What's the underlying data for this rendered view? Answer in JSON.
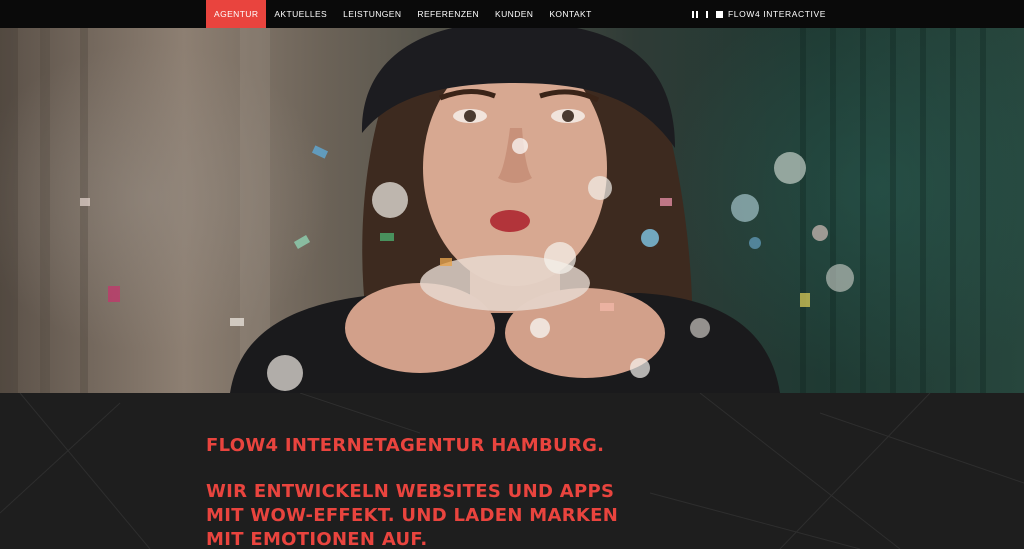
{
  "nav": {
    "items": [
      {
        "label": "AGENTUR",
        "active": true
      },
      {
        "label": "AKTUELLES",
        "active": false
      },
      {
        "label": "LEISTUNGEN",
        "active": false
      },
      {
        "label": "REFERENZEN",
        "active": false
      },
      {
        "label": "KUNDEN",
        "active": false
      },
      {
        "label": "KONTAKT",
        "active": false
      }
    ]
  },
  "brand": {
    "name": "FLOW4 INTERACTIVE",
    "icons": [
      "pause-icon",
      "bar-icon",
      "square-icon"
    ]
  },
  "hero": {
    "image": "woman-blowing-confetti"
  },
  "content": {
    "headline": "FLOW4 INTERNETAGENTUR HAMBURG.",
    "subline": "WIR ENTWICKELN WEBSITES UND APPS MIT WOW-EFFEKT. UND LADEN MARKEN MIT EMOTIONEN AUF."
  },
  "colors": {
    "accent": "#e9443e",
    "topbar": "#0a0a0a",
    "content_bg": "#1e1e1e"
  }
}
